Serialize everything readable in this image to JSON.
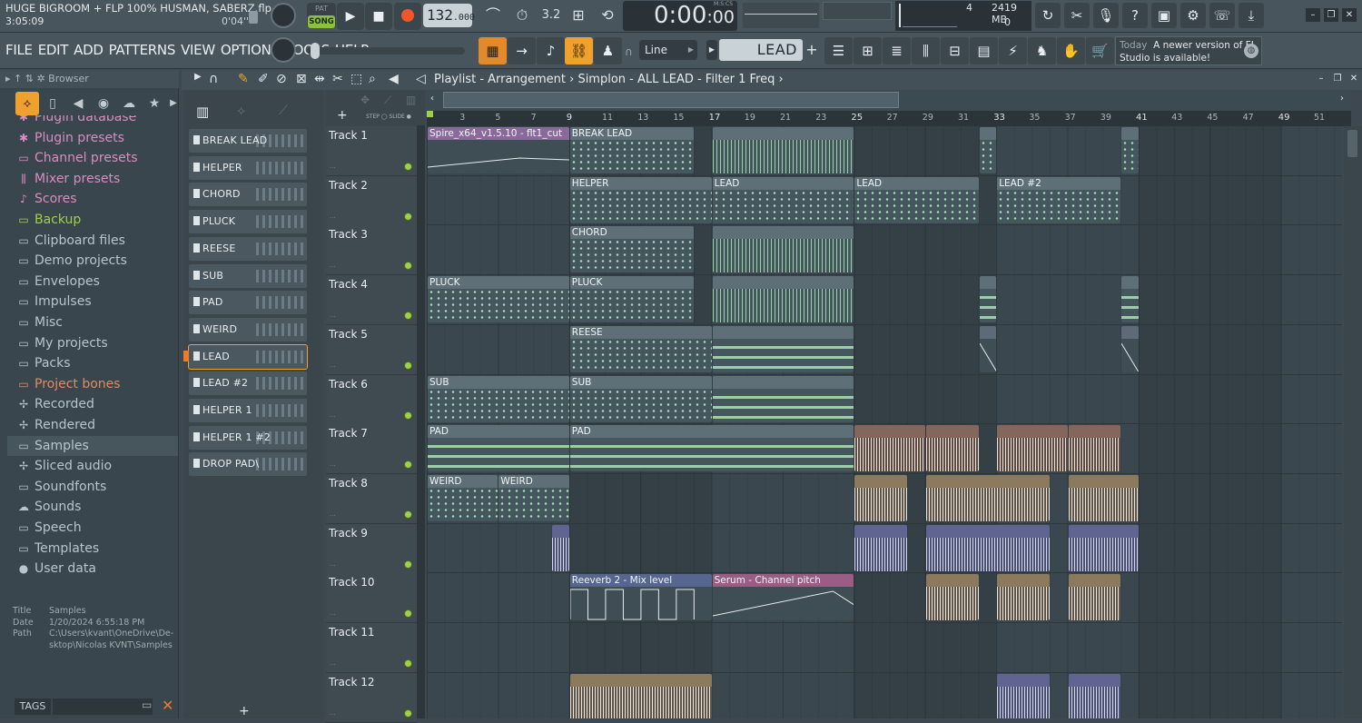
{
  "project": {
    "title": "HUGE BIGROOM + FLP 100% HUSMAN, SABERZ.flp",
    "time": "3:05:09",
    "time2": "0'04''"
  },
  "transport": {
    "pat_label": "PAT",
    "song_label": "SONG",
    "tempo": "132",
    "tempo_dec": ".000",
    "time_main": "0:00",
    "time_cs": ":00",
    "time_unit": "M:S:CS"
  },
  "cpu": {
    "a": "4",
    "b": "2419 MB",
    "c": "0"
  },
  "menu": [
    "FILE",
    "EDIT",
    "ADD",
    "PATTERNS",
    "VIEW",
    "OPTIONS",
    "TOOLS",
    "HELP"
  ],
  "snap": "Line",
  "pattern": "LEAD",
  "news": {
    "today": "Today",
    "text": "A newer version of FL Studio is available!"
  },
  "browser": {
    "header": "Browser",
    "items": [
      {
        "label": "Plugin database",
        "icon": "plugin-icon",
        "color": "#d98cc2"
      },
      {
        "label": "Plugin presets",
        "icon": "plugin-icon",
        "color": "#d98cc2"
      },
      {
        "label": "Channel presets",
        "icon": "channel-icon",
        "color": "#d98cc2"
      },
      {
        "label": "Mixer presets",
        "icon": "mixer-icon",
        "color": "#d98cc2"
      },
      {
        "label": "Scores",
        "icon": "note-icon",
        "color": "#d98cc2"
      },
      {
        "label": "Backup",
        "icon": "folder-icon",
        "color": "#9fd04a"
      },
      {
        "label": "Clipboard files",
        "icon": "folder-icon",
        "color": "#b6c6cc"
      },
      {
        "label": "Demo projects",
        "icon": "folder-icon",
        "color": "#b6c6cc"
      },
      {
        "label": "Envelopes",
        "icon": "folder-icon",
        "color": "#b6c6cc"
      },
      {
        "label": "Impulses",
        "icon": "folder-icon",
        "color": "#b6c6cc"
      },
      {
        "label": "Misc",
        "icon": "folder-icon",
        "color": "#b6c6cc"
      },
      {
        "label": "My projects",
        "icon": "folder-icon",
        "color": "#b6c6cc"
      },
      {
        "label": "Packs",
        "icon": "folder-icon",
        "color": "#b6c6cc"
      },
      {
        "label": "Project bones",
        "icon": "folder-icon",
        "color": "#e28a62"
      },
      {
        "label": "Recorded",
        "icon": "star-icon",
        "color": "#b6c6cc"
      },
      {
        "label": "Rendered",
        "icon": "star-icon",
        "color": "#b6c6cc"
      },
      {
        "label": "Samples",
        "icon": "folder-icon",
        "color": "#b6c6cc"
      },
      {
        "label": "Sliced audio",
        "icon": "star-icon",
        "color": "#b6c6cc"
      },
      {
        "label": "Soundfonts",
        "icon": "folder-icon",
        "color": "#b6c6cc"
      },
      {
        "label": "Sounds",
        "icon": "cloud-icon",
        "color": "#b6c6cc"
      },
      {
        "label": "Speech",
        "icon": "folder-icon",
        "color": "#b6c6cc"
      },
      {
        "label": "Templates",
        "icon": "folder-icon",
        "color": "#b6c6cc"
      },
      {
        "label": "User data",
        "icon": "user-icon",
        "color": "#b6c6cc"
      }
    ],
    "info": {
      "title_k": "Title",
      "title_v": "Samples",
      "date_k": "Date",
      "date_v": "1/20/2024 6:55:18 PM",
      "path_k": "Path",
      "path_v": "C:\\Users\\kvant\\OneDrive\\De-sktop\\Nicolas KVNT\\Samples"
    },
    "tags": "TAGS"
  },
  "playlist": {
    "title": "Playlist - Arrangement",
    "breadcrumb": "Simplon - ALL LEAD - Filter 1 Freq"
  },
  "channels": [
    "BREAK LEAD",
    "HELPER",
    "CHORD",
    "PLUCK",
    "REESE",
    "SUB",
    "PAD",
    "WEIRD",
    "LEAD",
    "LEAD #2",
    "HELPER 1",
    "HELPER 1 #2",
    "DROP PAD\\"
  ],
  "tracks": [
    "Track 1",
    "Track 2",
    "Track 3",
    "Track 4",
    "Track 5",
    "Track 6",
    "Track 7",
    "Track 8",
    "Track 9",
    "Track 10",
    "Track 11",
    "Track 12"
  ],
  "ruler": [
    "3",
    "5",
    "7",
    "9",
    "11",
    "13",
    "15",
    "17",
    "19",
    "21",
    "23",
    "25",
    "27",
    "29",
    "31",
    "33",
    "35",
    "37",
    "39",
    "41",
    "43",
    "45",
    "47",
    "49",
    "51"
  ],
  "clips": [
    {
      "track": 1,
      "start": 1,
      "end": 9,
      "label": "Spire_x64_v1.5.10 - flt1_cut",
      "kind": "aut purple"
    },
    {
      "track": 1,
      "start": 9,
      "end": 16,
      "label": "BREAK LEAD",
      "kind": "pat"
    },
    {
      "track": 1,
      "start": 17,
      "end": 25,
      "label": "",
      "kind": "pat dense"
    },
    {
      "track": 1,
      "start": 32,
      "end": 33,
      "label": "",
      "kind": "pat"
    },
    {
      "track": 1,
      "start": 40,
      "end": 41,
      "label": "",
      "kind": "pat"
    },
    {
      "track": 2,
      "start": 9,
      "end": 17,
      "label": "HELPER",
      "kind": "pat"
    },
    {
      "track": 2,
      "start": 17,
      "end": 25,
      "label": "LEAD",
      "kind": "pat"
    },
    {
      "track": 2,
      "start": 25,
      "end": 32,
      "label": "LEAD",
      "kind": "pat"
    },
    {
      "track": 2,
      "start": 33,
      "end": 40,
      "label": "LEAD #2",
      "kind": "pat"
    },
    {
      "track": 3,
      "start": 9,
      "end": 16,
      "label": "CHORD",
      "kind": "pat"
    },
    {
      "track": 3,
      "start": 17,
      "end": 25,
      "label": "",
      "kind": "pat dense"
    },
    {
      "track": 4,
      "start": 1,
      "end": 9,
      "label": "PLUCK",
      "kind": "pat"
    },
    {
      "track": 4,
      "start": 9,
      "end": 16,
      "label": "PLUCK",
      "kind": "pat"
    },
    {
      "track": 4,
      "start": 17,
      "end": 25,
      "label": "",
      "kind": "pat dense"
    },
    {
      "track": 4,
      "start": 32,
      "end": 33,
      "label": "",
      "kind": "pat bars"
    },
    {
      "track": 4,
      "start": 40,
      "end": 41,
      "label": "",
      "kind": "pat bars"
    },
    {
      "track": 5,
      "start": 9,
      "end": 17,
      "label": "REESE",
      "kind": "pat"
    },
    {
      "track": 5,
      "start": 17,
      "end": 25,
      "label": "",
      "kind": "pat bars"
    },
    {
      "track": 5,
      "start": 32,
      "end": 33,
      "label": "",
      "kind": "aut"
    },
    {
      "track": 5,
      "start": 40,
      "end": 41,
      "label": "",
      "kind": "aut"
    },
    {
      "track": 6,
      "start": 1,
      "end": 9,
      "label": "SUB",
      "kind": "pat"
    },
    {
      "track": 6,
      "start": 9,
      "end": 17,
      "label": "SUB",
      "kind": "pat"
    },
    {
      "track": 6,
      "start": 17,
      "end": 25,
      "label": "",
      "kind": "pat bars"
    },
    {
      "track": 7,
      "start": 1,
      "end": 9,
      "label": "PAD",
      "kind": "pat bars"
    },
    {
      "track": 7,
      "start": 9,
      "end": 25,
      "label": "PAD",
      "kind": "pat bars"
    },
    {
      "track": 7,
      "start": 25,
      "end": 29,
      "label": "",
      "kind": "aud"
    },
    {
      "track": 7,
      "start": 29,
      "end": 32,
      "label": "",
      "kind": "aud"
    },
    {
      "track": 7,
      "start": 33,
      "end": 37,
      "label": "",
      "kind": "aud"
    },
    {
      "track": 7,
      "start": 37,
      "end": 40,
      "label": "",
      "kind": "aud"
    },
    {
      "track": 8,
      "start": 1,
      "end": 5,
      "label": "WEIRD",
      "kind": "pat"
    },
    {
      "track": 8,
      "start": 5,
      "end": 9,
      "label": "WEIRD",
      "kind": "pat"
    },
    {
      "track": 8,
      "start": 25,
      "end": 28,
      "label": "",
      "kind": "aud3"
    },
    {
      "track": 8,
      "start": 29,
      "end": 36,
      "label": "",
      "kind": "aud3"
    },
    {
      "track": 8,
      "start": 37,
      "end": 41,
      "label": "",
      "kind": "aud3"
    },
    {
      "track": 9,
      "start": 8,
      "end": 9,
      "label": "",
      "kind": "aud2"
    },
    {
      "track": 9,
      "start": 25,
      "end": 28,
      "label": "",
      "kind": "aud2"
    },
    {
      "track": 9,
      "start": 29,
      "end": 36,
      "label": "",
      "kind": "aud2"
    },
    {
      "track": 9,
      "start": 37,
      "end": 41,
      "label": "",
      "kind": "aud2"
    },
    {
      "track": 10,
      "start": 9,
      "end": 17,
      "label": "Reeverb 2 - Mix level",
      "kind": "aut blue"
    },
    {
      "track": 10,
      "start": 17,
      "end": 25,
      "label": "Serum - Channel pitch",
      "kind": "aut pink"
    },
    {
      "track": 10,
      "start": 29,
      "end": 32,
      "label": "",
      "kind": "aud3"
    },
    {
      "track": 10,
      "start": 33,
      "end": 36,
      "label": "",
      "kind": "aud3"
    },
    {
      "track": 10,
      "start": 37,
      "end": 40,
      "label": "",
      "kind": "aud3"
    },
    {
      "track": 12,
      "start": 9,
      "end": 17,
      "label": "",
      "kind": "aud3"
    },
    {
      "track": 12,
      "start": 33,
      "end": 36,
      "label": "",
      "kind": "aud2"
    },
    {
      "track": 12,
      "start": 37,
      "end": 40,
      "label": "",
      "kind": "aud2"
    }
  ]
}
